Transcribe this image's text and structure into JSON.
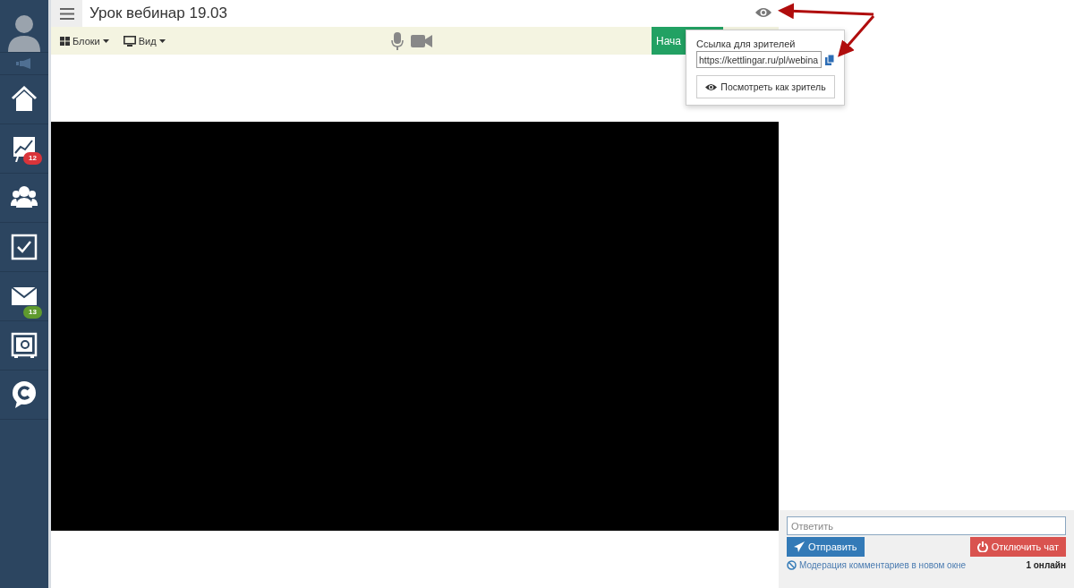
{
  "sidebar": {
    "items": [
      {
        "kind": "home"
      },
      {
        "kind": "chart",
        "badge": "12",
        "color": "#d9343a"
      },
      {
        "kind": "users"
      },
      {
        "kind": "tasks"
      },
      {
        "kind": "mail",
        "badge": "13",
        "color": "#5f9a2e"
      },
      {
        "kind": "safe"
      },
      {
        "kind": "chat"
      }
    ]
  },
  "header": {
    "title": "Урок вебинар 19.03"
  },
  "toolbar": {
    "menus": [
      {
        "kind": "blocks",
        "label": "Блоки"
      },
      {
        "kind": "view",
        "label": "Вид"
      }
    ],
    "start_button": "Нача"
  },
  "viewer_popup": {
    "label": "Ссылка для зрителей",
    "link": "https://kettlingar.ru/pl/webina",
    "view_button": "Посмотреть как зритель"
  },
  "chat": {
    "placeholder": "Ответить",
    "send_button": "Отправить",
    "disable_button": "Отключить чат",
    "moderation_link": "Модерация комментариев в новом окне",
    "online": "1 онлайн"
  }
}
